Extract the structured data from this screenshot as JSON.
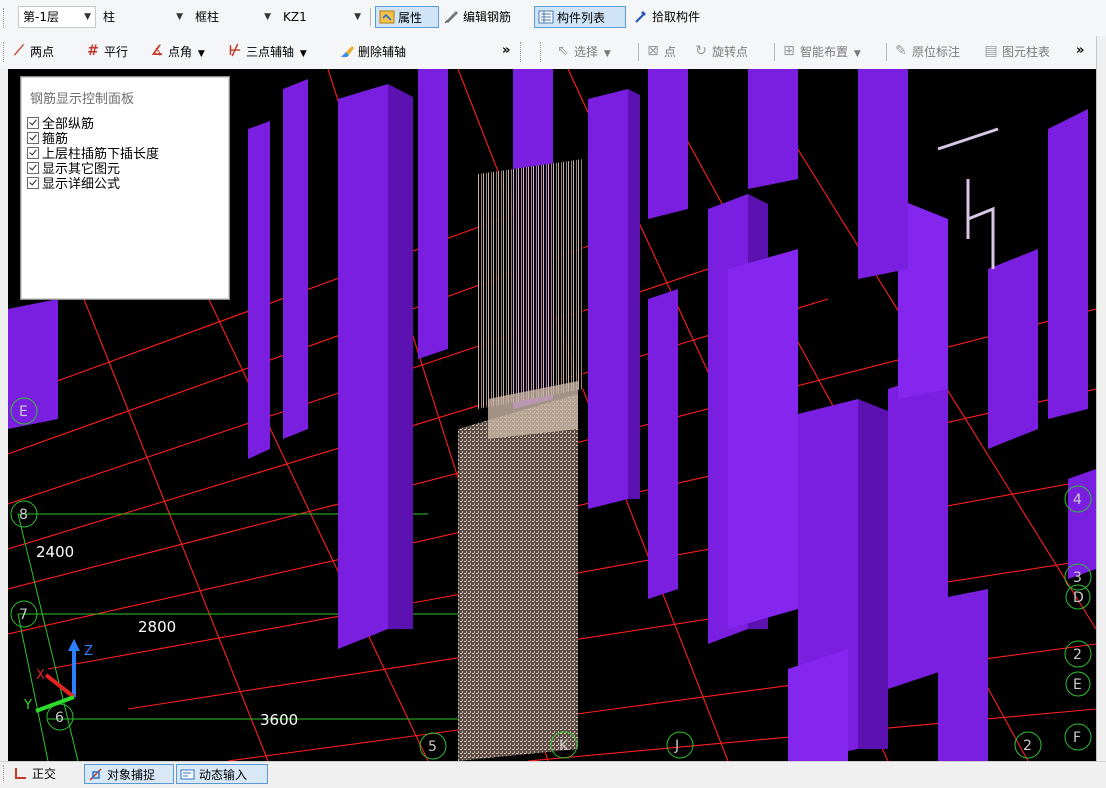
{
  "toolbar1": {
    "floor": "第-1层",
    "category": "柱",
    "subtype": "框柱",
    "component": "KZ1",
    "attributes": "属性",
    "edit_rebar": "编辑钢筋",
    "component_list": "构件列表",
    "pick_component": "拾取构件"
  },
  "toolbar2": {
    "two_point": "两点",
    "parallel": "平行",
    "point_angle": "点角",
    "three_point_axis": "三点辅轴",
    "delete_axis": "删除辅轴",
    "more": "»",
    "select": "选择",
    "point": "点",
    "rotate_point": "旋转点",
    "smart_layout": "智能布置",
    "in_place_mark": "原位标注",
    "element_column_table": "图元柱表",
    "more2": "»"
  },
  "panel": {
    "title": "钢筋显示控制面板",
    "options": [
      {
        "label": "全部纵筋",
        "checked": true
      },
      {
        "label": "箍筋",
        "checked": true
      },
      {
        "label": "上层柱插筋下插长度",
        "checked": true
      },
      {
        "label": "显示其它图元",
        "checked": true
      },
      {
        "label": "显示详细公式",
        "checked": true
      }
    ]
  },
  "viewport": {
    "axis_labels": [
      "2400",
      "2800",
      "3600"
    ],
    "grid_bubbles_left": [
      "8",
      "7",
      "6",
      "5",
      "E"
    ],
    "grid_bubbles_right": [
      "4",
      "3",
      "D",
      "2",
      "E",
      "F"
    ],
    "grid_bubbles_bottom": [
      "J",
      "2",
      "K"
    ],
    "axes": {
      "x": "X",
      "y": "Y",
      "z": "Z"
    },
    "colors": {
      "column": "#7a1fe0",
      "grid_red": "#ff1e1e",
      "grid_green": "#2ec42e",
      "rebar": "#c8b4a6"
    }
  },
  "statusbar": {
    "ortho": "正交",
    "snap": "对象捕捉",
    "dynamic_input": "动态输入"
  }
}
